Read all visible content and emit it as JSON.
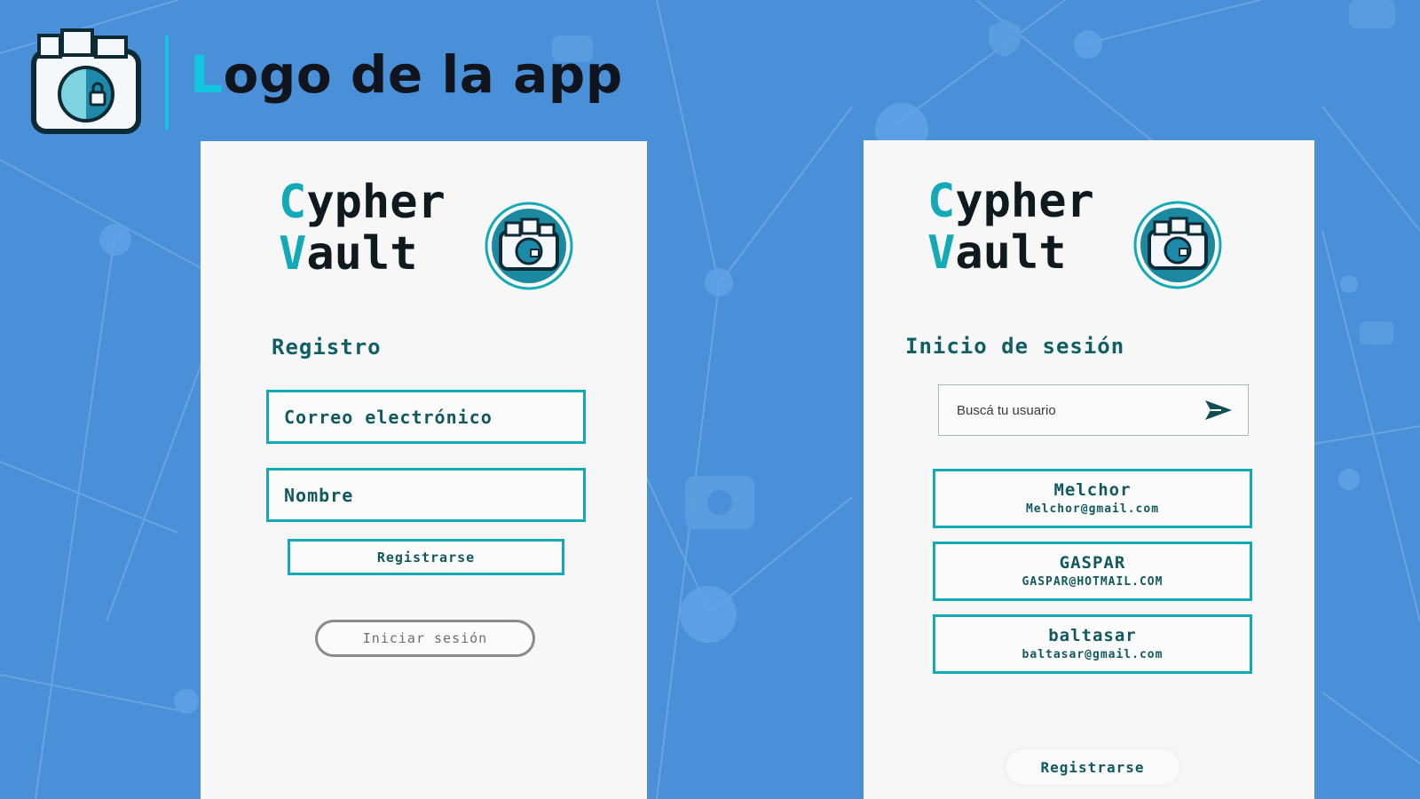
{
  "slide": {
    "title_first_letter": "L",
    "title_rest": "ogo de la app"
  },
  "brand": {
    "line1_cap": "C",
    "line1_rest": "ypher",
    "line2_cap": "V",
    "line2_rest": "ault"
  },
  "register_screen": {
    "title": "Registro",
    "email_placeholder": "Correo electrónico",
    "name_placeholder": "Nombre",
    "register_button": "Registrarse",
    "login_button": "Iniciar sesión"
  },
  "login_screen": {
    "title": "Inicio de sesión",
    "search_placeholder": "Buscá tu usuario",
    "users": [
      {
        "name": "Melchor",
        "email": "Melchor@gmail.com"
      },
      {
        "name": "GASPAR",
        "email": "GASPAR@HOTMAIL.COM"
      },
      {
        "name": "baltasar",
        "email": "baltasar@gmail.com"
      }
    ],
    "register_link": "Registrarse"
  },
  "colors": {
    "background": "#4a90d9",
    "accent": "#12c6e0",
    "teal": "#14a9b7",
    "dark_teal": "#11595f",
    "card": "#f7f7f7"
  },
  "icons": {
    "app_logo": "folder-lock-icon",
    "send": "send-arrow-icon"
  }
}
